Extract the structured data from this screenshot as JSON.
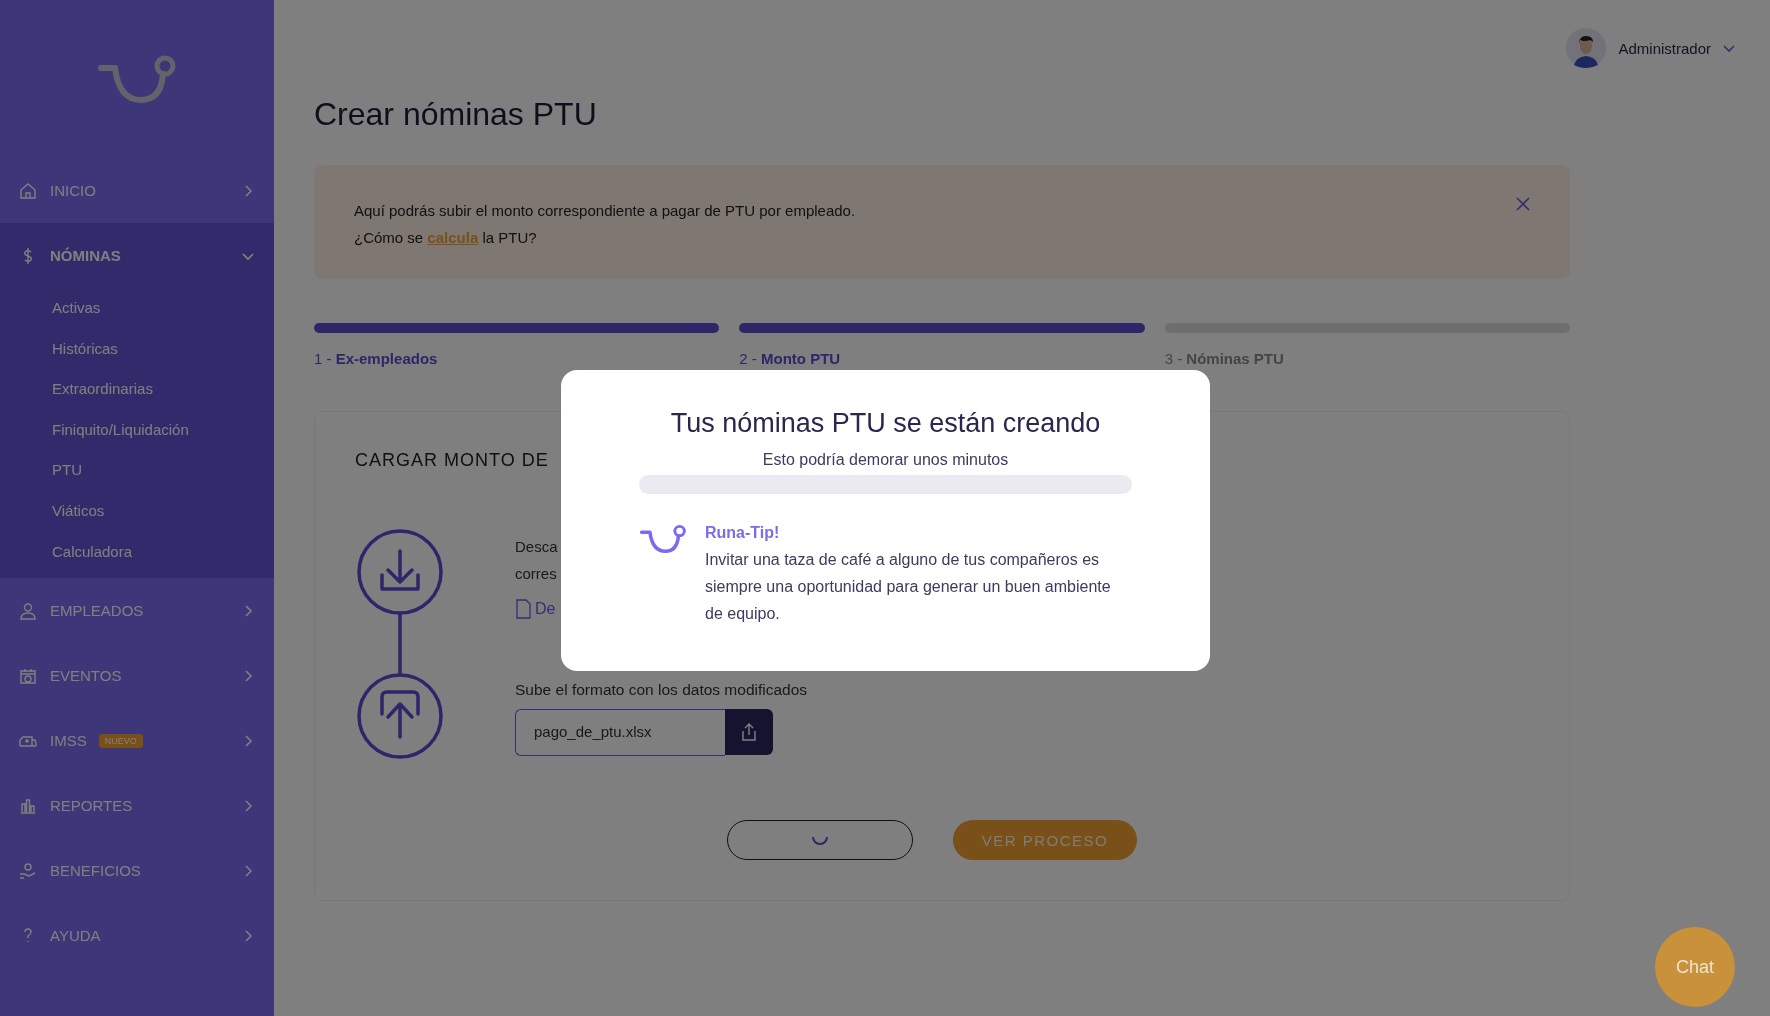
{
  "sidebar": {
    "items": [
      {
        "label": "INICIO",
        "expanded": false
      },
      {
        "label": "NÓMINAS",
        "expanded": true,
        "children": [
          {
            "label": "Activas"
          },
          {
            "label": "Históricas"
          },
          {
            "label": "Extraordinarias"
          },
          {
            "label": "Finiquito/Liquidación"
          },
          {
            "label": "PTU"
          },
          {
            "label": "Viáticos"
          },
          {
            "label": "Calculadora"
          }
        ]
      },
      {
        "label": "EMPLEADOS",
        "expanded": false
      },
      {
        "label": "EVENTOS",
        "expanded": false
      },
      {
        "label": "IMSS",
        "badge": "NUEVO",
        "expanded": false
      },
      {
        "label": "REPORTES",
        "expanded": false
      },
      {
        "label": "BENEFICIOS",
        "expanded": false
      },
      {
        "label": "AYUDA",
        "expanded": false
      }
    ]
  },
  "header": {
    "user": "Administrador"
  },
  "page_title": "Crear nóminas PTU",
  "banner": {
    "line_1": "Aquí podrás subir el monto correspondiente a pagar de PTU por empleado.",
    "line_2_before": "¿Cómo se ",
    "line_2_link": "calcula",
    "line_2_after": " la PTU?"
  },
  "steps": [
    {
      "label": "1 - **Ex-empleados**",
      "completed": true
    },
    {
      "label": "2 - **Monto PTU**",
      "completed": true
    },
    {
      "label": "3 - **Nóminas PTU**",
      "completed": false
    }
  ],
  "card": {
    "title": "CARGAR MONTO DE",
    "download_lines": [
      "Desca",
      "corres"
    ],
    "download_link": "De",
    "upload_label": "Sube el formato con los datos modificados",
    "file_value": "pago_de_ptu.xlsx",
    "back_loading": true,
    "primary_button": "VER PROCESO"
  },
  "modal": {
    "title": "Tus nóminas PTU se están creando",
    "subtitle": "Esto podría demorar unos minutos",
    "tip_title": "Runa-Tip!",
    "tip_text": "Invitar una taza de café a alguno de tus compañeros es siempre una oportunidad para generar un buen ambiente de equipo."
  },
  "chat": {
    "label": "Chat"
  }
}
